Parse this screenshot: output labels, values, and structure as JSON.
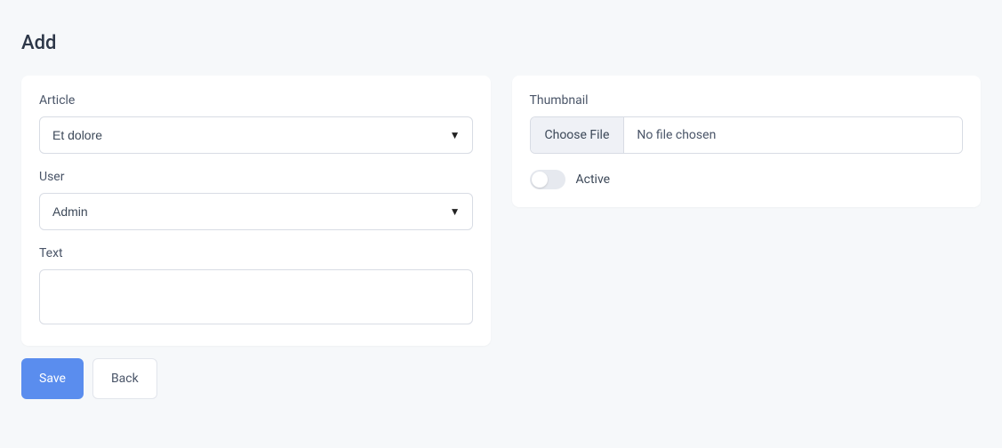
{
  "page": {
    "title": "Add"
  },
  "form": {
    "article": {
      "label": "Article",
      "value": "Et dolore"
    },
    "user": {
      "label": "User",
      "value": "Admin"
    },
    "text": {
      "label": "Text",
      "value": ""
    }
  },
  "thumbnail": {
    "label": "Thumbnail",
    "button": "Choose File",
    "status": "No file chosen"
  },
  "active": {
    "label": "Active",
    "checked": false
  },
  "actions": {
    "save": "Save",
    "back": "Back"
  }
}
